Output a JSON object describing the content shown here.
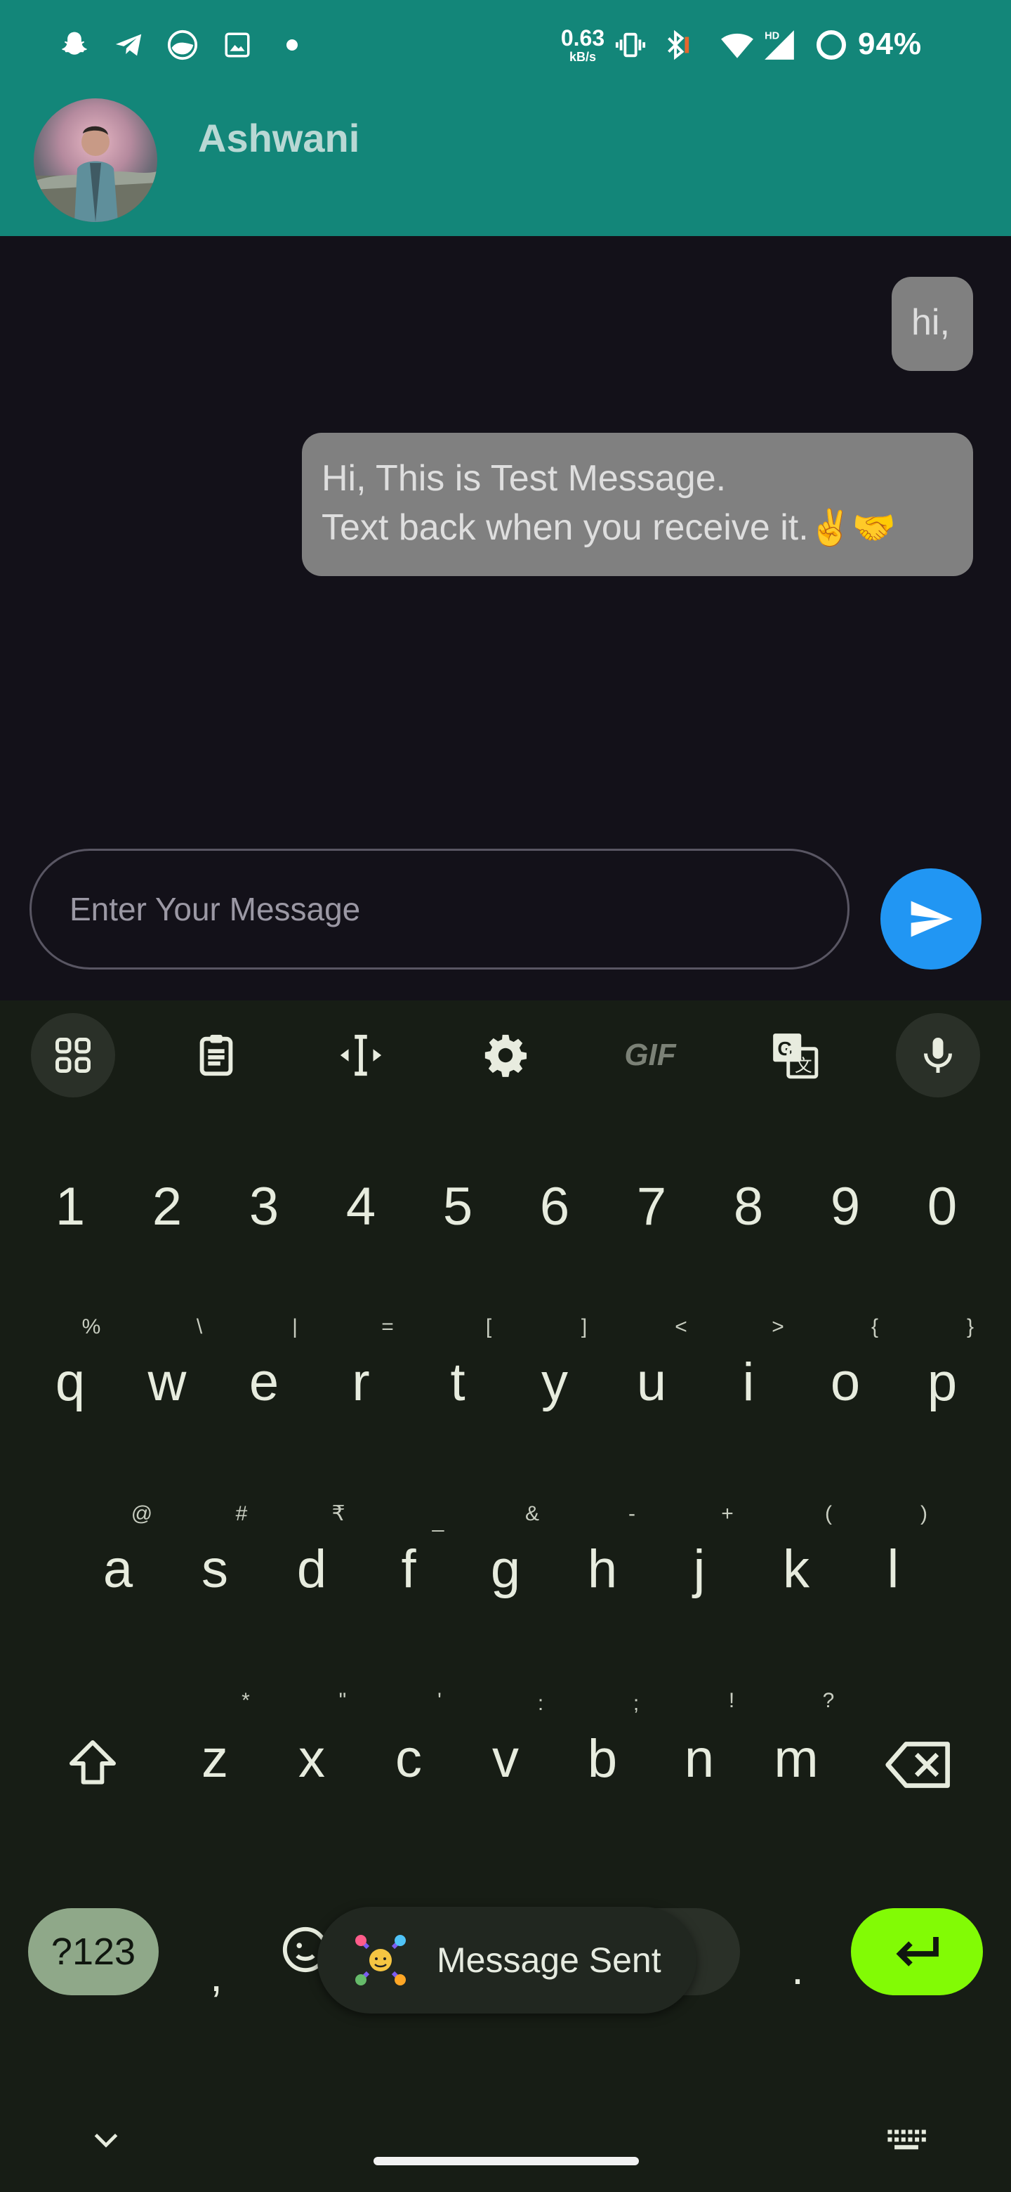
{
  "status_bar": {
    "net_speed_value": "0.63",
    "net_speed_unit": "kB/s",
    "battery_percent": "94%",
    "icons": [
      "snapchat-icon",
      "telegram-icon",
      "app-icon",
      "gallery-icon",
      "dot-icon",
      "vibrate-icon",
      "bluetooth-icon",
      "wifi-icon",
      "signal-icon",
      "battery-ring-icon"
    ]
  },
  "header": {
    "contact_name": "Ashwani"
  },
  "chat": {
    "messages": [
      {
        "text": "hi,"
      },
      {
        "line1": "Hi, This is Test Message.",
        "line2": "Text back when you receive it.",
        "emojis": "✌️🤝"
      }
    ]
  },
  "composer": {
    "placeholder": "Enter Your Message"
  },
  "keyboard": {
    "toolbar": {
      "gif_label": "GIF"
    },
    "number_row": [
      "1",
      "2",
      "3",
      "4",
      "5",
      "6",
      "7",
      "8",
      "9",
      "0"
    ],
    "row1": [
      "q",
      "w",
      "e",
      "r",
      "t",
      "y",
      "u",
      "i",
      "o",
      "p"
    ],
    "row1_hints": [
      "%",
      "\\",
      "|",
      "=",
      "[",
      "]",
      "<",
      ">",
      "{",
      "}"
    ],
    "row2": [
      "a",
      "s",
      "d",
      "f",
      "g",
      "h",
      "j",
      "k",
      "l"
    ],
    "row2_hints": [
      "@",
      "#",
      "₹",
      "_",
      "&",
      "-",
      "+",
      "(",
      ")"
    ],
    "row3": [
      "z",
      "x",
      "c",
      "v",
      "b",
      "n",
      "m"
    ],
    "row3_hints": [
      "*",
      "\"",
      "'",
      ":",
      ";",
      "!",
      "?"
    ],
    "symbols_label": "?123",
    "comma_label": ",",
    "period_label": ".",
    "accent_color": "#82fb05"
  },
  "toast": {
    "text": "Message Sent"
  }
}
